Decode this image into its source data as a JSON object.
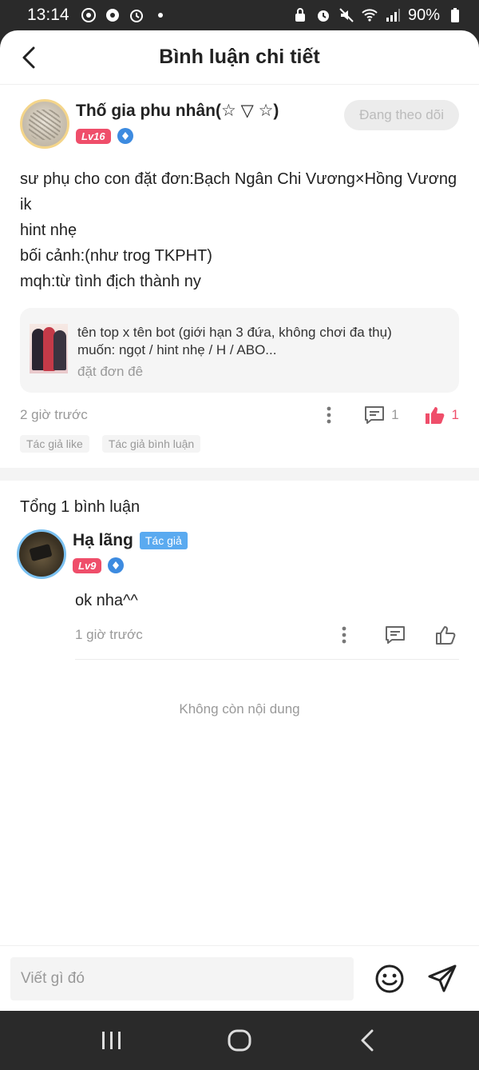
{
  "status_bar": {
    "time": "13:14",
    "battery": "90%"
  },
  "header": {
    "title": "Bình luận chi tiết"
  },
  "post": {
    "user_name": "Thố gia phu nhân(☆ ▽ ☆)",
    "level": "Lv16",
    "follow_label": "Đang theo dõi",
    "body_lines": [
      "sư phụ cho con đặt đơn:Bạch Ngân Chi Vương×Hồng Vương ik",
      "hint nhẹ",
      "bối cảnh:(như trog TKPHT)",
      "mqh:từ tình địch thành ny"
    ],
    "quote": {
      "line1": "tên top x tên bot (giới hạn 3 đứa, không chơi đa thụ)",
      "line2": "muốn: ngọt / hint nhẹ / H / ABO...",
      "subtitle": "đặt đơn đê"
    },
    "time_ago": "2 giờ trước",
    "reply_count": "1",
    "like_count": "1",
    "tags": [
      "Tác giả like",
      "Tác giả bình luận"
    ]
  },
  "comments": {
    "total_label": "Tổng 1 bình luận",
    "items": [
      {
        "user_name": "Hạ lãng",
        "author_tag": "Tác giả",
        "level": "Lv9",
        "text": "ok nha^^",
        "time_ago": "1 giờ trước"
      }
    ],
    "end_label": "Không còn nội dung"
  },
  "input_bar": {
    "placeholder": "Viết gì đó"
  },
  "colors": {
    "accent_red": "#ef4e6a",
    "author_blue": "#5aaaf0",
    "muted_text": "#999999"
  },
  "icons": [
    "back-icon",
    "more-icon",
    "comment-icon",
    "thumbs-up-icon",
    "emoji-icon",
    "send-icon",
    "diamond-icon",
    "recent-apps-icon",
    "home-icon",
    "nav-back-icon"
  ]
}
